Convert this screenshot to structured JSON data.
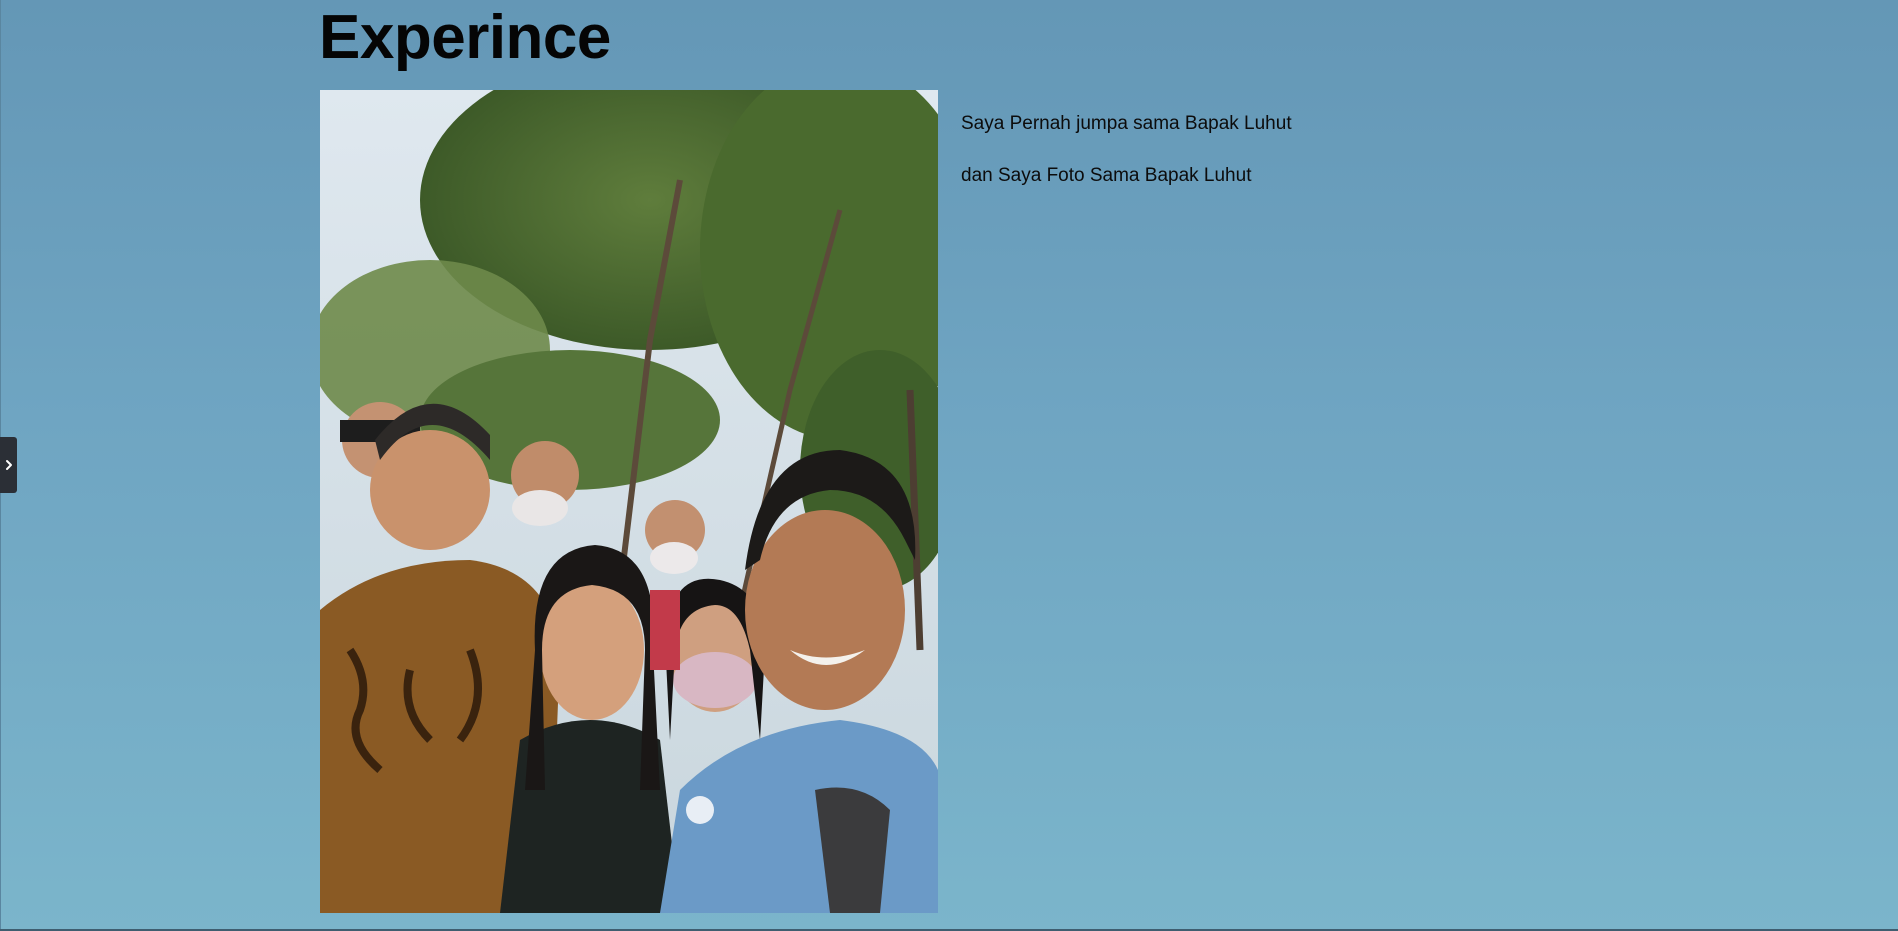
{
  "page": {
    "heading": "Experince",
    "lines": [
      "Saya Pernah jumpa sama Bapak Luhut",
      "dan Saya Foto Sama Bapak Luhut"
    ]
  },
  "photo": {
    "subject": "group selfie outdoors under trees"
  },
  "side_toggle": {
    "icon": "chevron-right-icon"
  },
  "colors": {
    "background_top": "#6497b6",
    "background_bottom": "#7bb5cb",
    "heading": "#050505",
    "text": "#0c0c0c",
    "toggle": "#2b2f36"
  }
}
